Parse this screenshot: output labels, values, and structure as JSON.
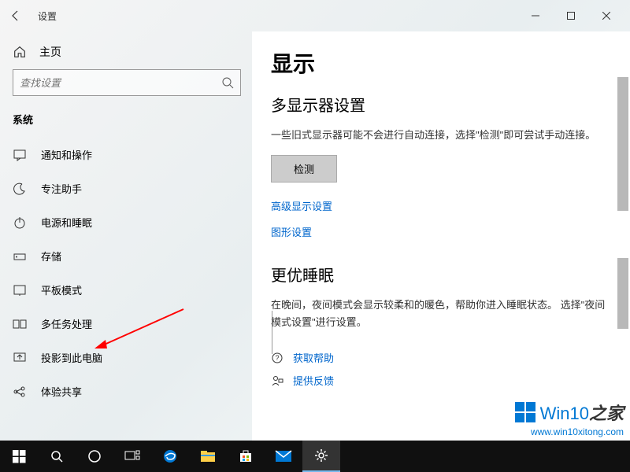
{
  "titlebar": {
    "title": "设置"
  },
  "sidebar": {
    "home": "主页",
    "search_placeholder": "查找设置",
    "group": "系统",
    "items": [
      {
        "label": "通知和操作",
        "icon": "message-icon"
      },
      {
        "label": "专注助手",
        "icon": "moon-icon"
      },
      {
        "label": "电源和睡眠",
        "icon": "power-icon"
      },
      {
        "label": "存储",
        "icon": "storage-icon"
      },
      {
        "label": "平板模式",
        "icon": "tablet-icon"
      },
      {
        "label": "多任务处理",
        "icon": "multitask-icon"
      },
      {
        "label": "投影到此电脑",
        "icon": "project-icon"
      },
      {
        "label": "体验共享",
        "icon": "share-icon"
      }
    ]
  },
  "content": {
    "heading": "显示",
    "section1_title": "多显示器设置",
    "section1_text": "一些旧式显示器可能不会进行自动连接，选择\"检测\"即可尝试手动连接。",
    "detect_btn": "检测",
    "link1": "高级显示设置",
    "link2": "图形设置",
    "section2_title": "更优睡眠",
    "section2_text": "在晚间，夜间模式会显示较柔和的暖色，帮助你进入睡眠状态。 选择\"夜间模式设置\"进行设置。",
    "help": "获取帮助",
    "feedback": "提供反馈"
  },
  "watermark": {
    "brand1": "Win10",
    "brand2": "之家",
    "url": "www.win10xitong.com"
  }
}
